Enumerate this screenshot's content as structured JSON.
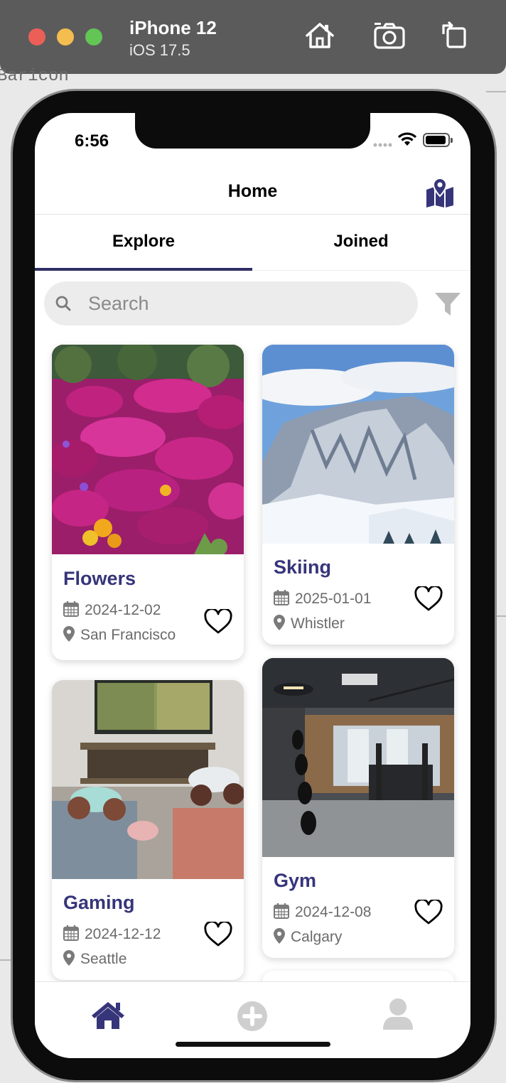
{
  "simulator": {
    "device_name": "iPhone 12",
    "os_version": "iOS 17.5",
    "traffic_colors": [
      "#ec5f57",
      "#f4bd4f",
      "#62c555"
    ],
    "buttons": [
      "home-icon",
      "screenshot-icon",
      "rotate-icon"
    ]
  },
  "background": {
    "fragment_text": "Baricon"
  },
  "status_bar": {
    "time": "6:56"
  },
  "header": {
    "title": "Home",
    "right_icon": "map-icon"
  },
  "tabs": [
    {
      "label": "Explore",
      "active": true
    },
    {
      "label": "Joined",
      "active": false
    }
  ],
  "search": {
    "placeholder": "Search",
    "value": ""
  },
  "filter_icon": "filter-icon",
  "cards": [
    {
      "title": "Flowers",
      "date": "2024-12-02",
      "location": "San Francisco",
      "liked": false,
      "image": "flowers-image"
    },
    {
      "title": "Skiing",
      "date": "2025-01-01",
      "location": "Whistler",
      "liked": false,
      "image": "skiing-image"
    },
    {
      "title": "Gaming",
      "date": "2024-12-12",
      "location": "Seattle",
      "liked": false,
      "image": "gaming-image"
    },
    {
      "title": "Gym",
      "date": "2024-12-08",
      "location": "Calgary",
      "liked": false,
      "image": "gym-image"
    }
  ],
  "tab_bar": [
    {
      "name": "home",
      "icon": "home-icon",
      "active": true
    },
    {
      "name": "create",
      "icon": "plus-circle-icon",
      "active": false
    },
    {
      "name": "profile",
      "icon": "user-icon",
      "active": false
    }
  ],
  "colors": {
    "accent": "#36357a",
    "tab_indicator": "#2f2e63",
    "inactive_icon": "#cfcfcf",
    "search_bg": "#ececec"
  }
}
